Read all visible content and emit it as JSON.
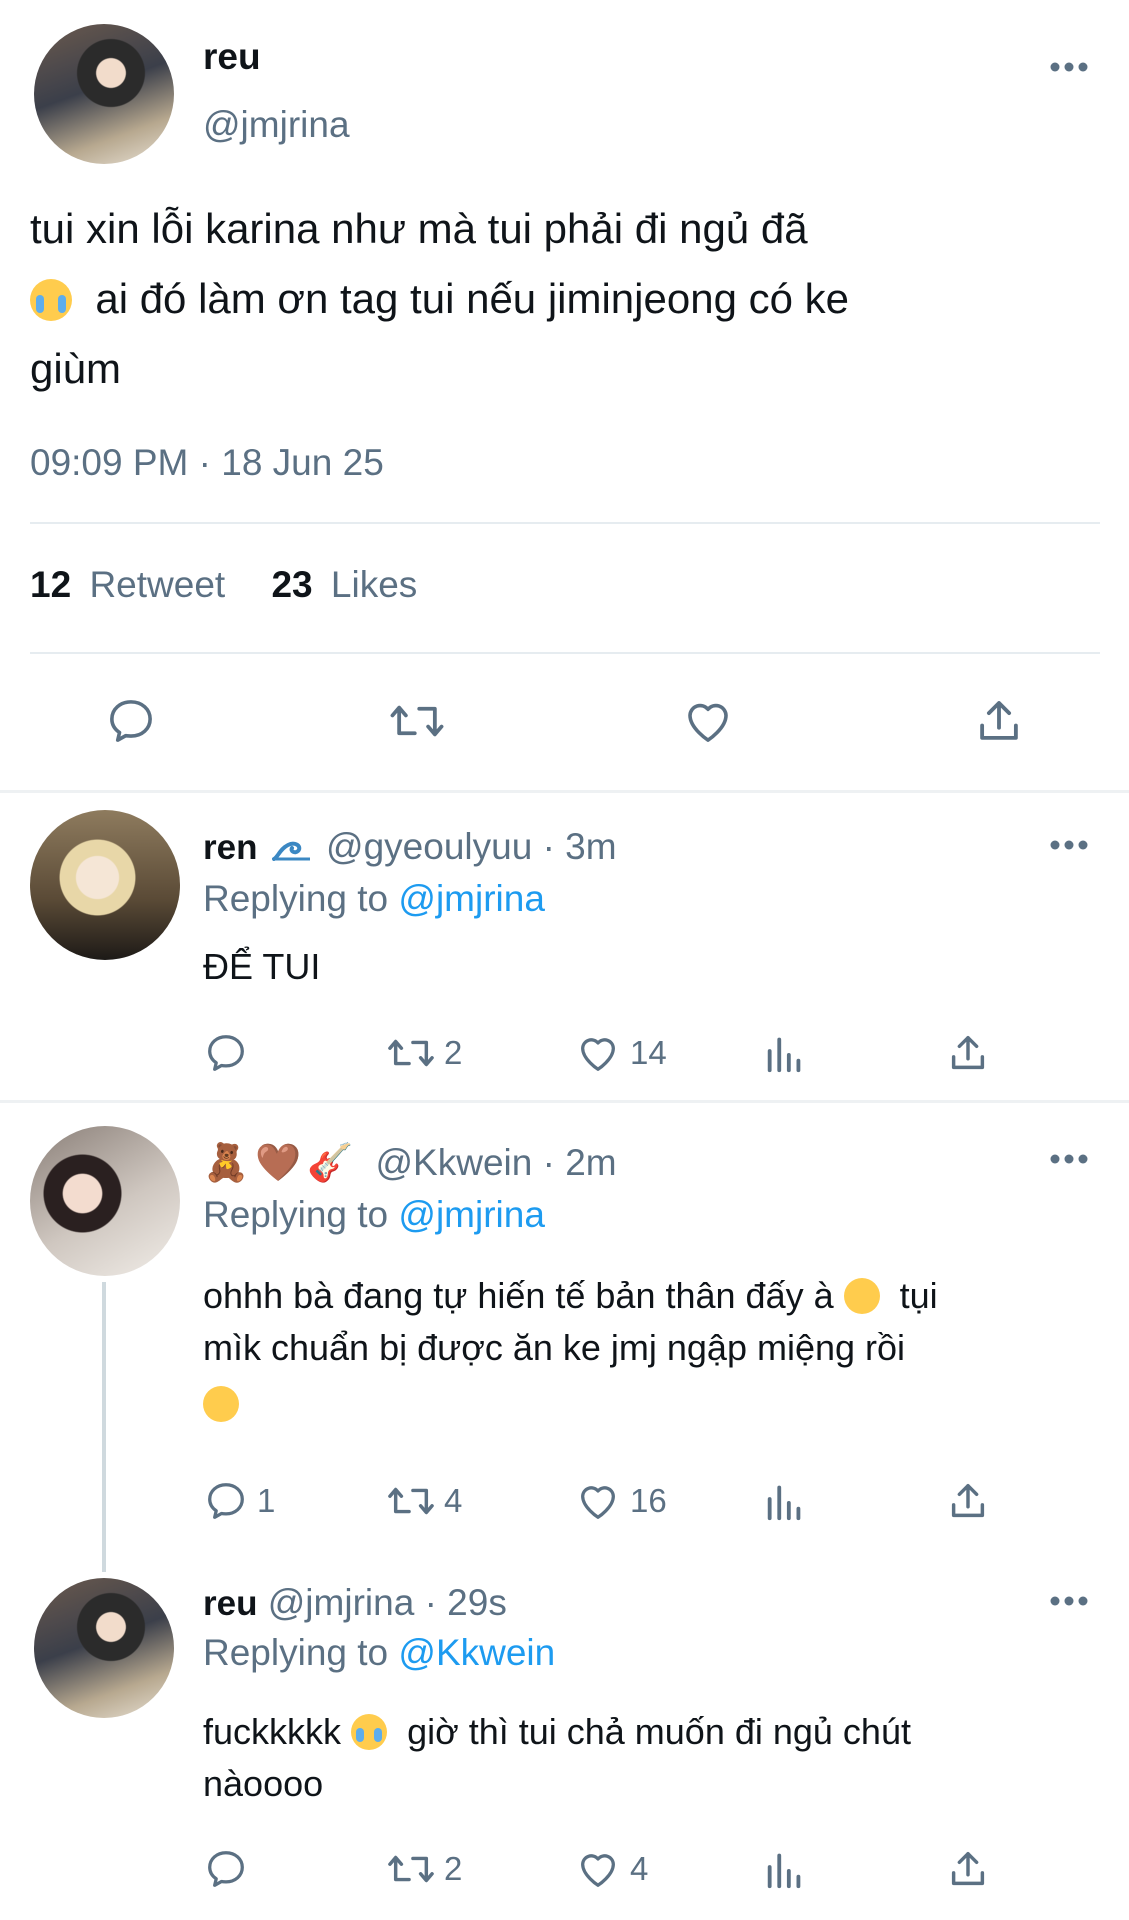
{
  "tweet": {
    "author_name": "reu",
    "author_handle": "@jmjrina",
    "text_line1": "tui xin lỗi karina như mà tui phải đi ngủ đã",
    "text_line2": "ai đó làm ơn tag tui nếu jiminjeong có ke",
    "text_line3": "giùm",
    "timestamp": "09:09 PM · 18 Jun 25",
    "retweet_count": "12",
    "retweet_label": "Retweet",
    "likes_count": "23",
    "likes_label": "Likes"
  },
  "replies": [
    {
      "name": "ren",
      "handle": "@gyeoulyuu",
      "time": "· 3m",
      "replying_label": "Replying to",
      "replying_to": "@jmjrina",
      "text": "ĐỂ TUI",
      "reply_count": "",
      "retweet_count": "2",
      "like_count": "14"
    },
    {
      "name_emojis": "🧸🤎🎸",
      "handle": "@Kkwein",
      "time": "· 2m",
      "replying_label": "Replying to",
      "replying_to": "@jmjrina",
      "text_line1a": "ohhh bà đang tự hiến tế bản thân đấy à",
      "text_line1b": "tụi",
      "text_line2": "mìk chuẩn bị được ăn ke jmj ngập miệng rồi",
      "reply_count": "1",
      "retweet_count": "4",
      "like_count": "16"
    },
    {
      "name": "reu",
      "handle": "@jmjrina",
      "time": "· 29s",
      "replying_label": "Replying to",
      "replying_to": "@Kkwein",
      "text_line1a": "fuckkkkk",
      "text_line1b": "giờ thì tui chả muốn đi ngủ chút",
      "text_line2": "nàoooo",
      "reply_count": "",
      "retweet_count": "2",
      "like_count": "4"
    }
  ],
  "colors": {
    "accent": "#1d9bf0",
    "muted": "#5b7083",
    "divider": "#e6ecf0"
  }
}
